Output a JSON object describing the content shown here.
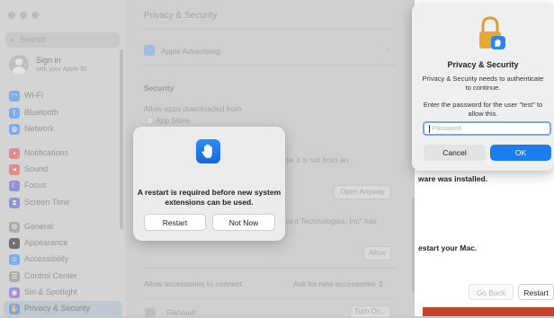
{
  "sidebar": {
    "search_placeholder": "Search",
    "account": {
      "title": "Sign in",
      "subtitle": "with your Apple ID"
    },
    "items": [
      {
        "label": "Wi-Fi",
        "icon": "wifi-icon",
        "color": "#3c8ef0"
      },
      {
        "label": "Bluetooth",
        "icon": "bluetooth-icon",
        "color": "#3c8ef0"
      },
      {
        "label": "Network",
        "icon": "globe-icon",
        "color": "#3c8ef0"
      },
      {
        "label": "Notifications",
        "icon": "bell-icon",
        "color": "#e9544c"
      },
      {
        "label": "Sound",
        "icon": "speaker-icon",
        "color": "#e9544c"
      },
      {
        "label": "Focus",
        "icon": "moon-icon",
        "color": "#5d5ed8"
      },
      {
        "label": "Screen Time",
        "icon": "hourglass-icon",
        "color": "#5d5ed8"
      },
      {
        "label": "General",
        "icon": "gear-icon",
        "color": "#8e8e93"
      },
      {
        "label": "Appearance",
        "icon": "appearance-icon",
        "color": "#1f1f1f"
      },
      {
        "label": "Accessibility",
        "icon": "accessibility-icon",
        "color": "#3c8ef0"
      },
      {
        "label": "Control Center",
        "icon": "control-center-icon",
        "color": "#8e8e93"
      },
      {
        "label": "Siri & Spotlight",
        "icon": "siri-icon",
        "color": "#7a5be0"
      },
      {
        "label": "Privacy & Security",
        "icon": "hand-icon",
        "color": "#3c8ef0",
        "selected": true
      }
    ]
  },
  "main": {
    "title": "Privacy & Security",
    "apple_advertising": "Apple Advertising",
    "security_heading": "Security",
    "allow_apps_label": "Allow apps downloaded from",
    "app_store_option": "App Store",
    "blocked_text_fragment": "se it is not from an",
    "open_anyway_button": "Open Anyway",
    "developer_text_fragment": "oint Technologies, Inc\" has",
    "allow_button": "Allow",
    "accessories_label": "Allow accessories to connect",
    "accessories_value": "Ask for new accessories",
    "filevault_label": "FileVault",
    "turn_on_button": "Turn On..."
  },
  "right_window": {
    "installed_text": "ware was installed.",
    "restart_text": "estart your Mac.",
    "go_back_button": "Go Back",
    "restart_button": "Restart"
  },
  "restart_dialog": {
    "message": "A restart is required before new system extensions can be used.",
    "restart_button": "Restart",
    "not_now_button": "Not Now"
  },
  "auth_dialog": {
    "title": "Privacy & Security",
    "message": "Privacy & Security needs to authenticate to continue.",
    "prompt": "Enter the password for the user \"test\" to allow this.",
    "password_placeholder": "Password",
    "cancel_button": "Cancel",
    "ok_button": "OK"
  },
  "colors": {
    "accent": "#1a7ef0",
    "lock_gold": "#e6a937",
    "lock_blue": "#2c84f0"
  }
}
